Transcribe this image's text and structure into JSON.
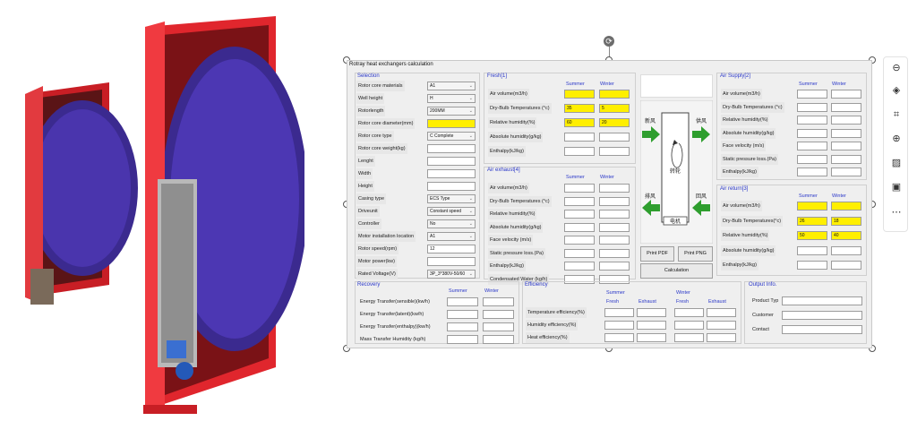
{
  "window_title": "Rotray heat exchangers calculation",
  "selection": {
    "title": "Selection",
    "rows": [
      {
        "label": "Rotor core materials",
        "value": "A1",
        "kind": "select"
      },
      {
        "label": "Well height",
        "value": "H",
        "kind": "select"
      },
      {
        "label": "Rotorlength",
        "value": "200MM",
        "kind": "select"
      },
      {
        "label": "Rotor core diameter(mm)",
        "value": "",
        "kind": "yellow"
      },
      {
        "label": "Rotor core type",
        "value": "C Complete",
        "kind": "select"
      },
      {
        "label": "Rotor core weight(kg)",
        "value": "",
        "kind": "input"
      },
      {
        "label": "Lenght",
        "value": "",
        "kind": "input"
      },
      {
        "label": "Width",
        "value": "",
        "kind": "input"
      },
      {
        "label": "Height",
        "value": "",
        "kind": "input"
      },
      {
        "label": "Casing type",
        "value": "ECS Type",
        "kind": "select"
      },
      {
        "label": "Driveunit",
        "value": "Constant speed",
        "kind": "select"
      },
      {
        "label": "Controller",
        "value": "No",
        "kind": "select"
      },
      {
        "label": "Motor installation location",
        "value": "A1",
        "kind": "select"
      },
      {
        "label": "Rotor speed(rpm)",
        "value": "12",
        "kind": "input"
      },
      {
        "label": "Motor power(kw)",
        "value": "",
        "kind": "input"
      },
      {
        "label": "Rated Voltage(V)",
        "value": "3P_3*380V-50/60",
        "kind": "select"
      }
    ]
  },
  "fresh": {
    "title": "Fresh[1]",
    "summer": "Summer",
    "winter": "Winter",
    "rows": [
      {
        "label": "Air volume(m3/h)",
        "summer": "",
        "winter": "",
        "yellow": true
      },
      {
        "label": "Dry-Bulb Temperatures (°c)",
        "summer": "35",
        "winter": "5",
        "yellow": true
      },
      {
        "label": "Relative humidity(%)",
        "summer": "60",
        "winter": "20",
        "yellow": true
      },
      {
        "label": "Absolute humidity(g/kg)",
        "summer": "",
        "winter": "",
        "yellow": false
      },
      {
        "label": "Enthalpy(kJ/kg)",
        "summer": "",
        "winter": "",
        "yellow": false
      }
    ]
  },
  "exhaust": {
    "title": "Air exhaust[4]",
    "summer": "Summer",
    "winter": "Winter",
    "rows": [
      {
        "label": "Air volume(m3/h)"
      },
      {
        "label": "Dry-Bulb Temperatures (°c)"
      },
      {
        "label": "Relative humidity(%)"
      },
      {
        "label": "Absolute humidity(g/kg)"
      },
      {
        "label": "Face velocity (m/s)"
      },
      {
        "label": "Static pressure loss.(Pa)"
      },
      {
        "label": "Enthalpy(kJ/kg)"
      },
      {
        "label": "Condensated Water (kg/h)"
      }
    ]
  },
  "diagram": {
    "fresh_air": "新风",
    "supply_air": "供风",
    "exhaust_air": "排风",
    "return_air": "回风",
    "rotor": "转轮",
    "motor": "电机",
    "arrow_color": "#2e9e2e"
  },
  "buttons": {
    "print_pdf": "Print PDF",
    "print_png": "Print PNG",
    "calculation": "Calculation"
  },
  "supply": {
    "title": "Air Supply[2]",
    "summer": "Summer",
    "winter": "Winter",
    "rows": [
      {
        "label": "Air volume(m3/h)"
      },
      {
        "label": "Dry-Bulb Temperatures (°c)"
      },
      {
        "label": "Relative humidity(%)"
      },
      {
        "label": "Absolute humidity(g/kg)"
      },
      {
        "label": "Face velocity (m/s)"
      },
      {
        "label": "Static pressure loss.(Pa)"
      },
      {
        "label": "Enthalpy(kJ/kg)"
      }
    ]
  },
  "return": {
    "title": "Air return[3]",
    "summer": "Summer",
    "winter": "Winter",
    "rows": [
      {
        "label": "Air volume(m3/h)",
        "summer": "",
        "winter": "",
        "yellow": true
      },
      {
        "label": "Dry-Bulb Temperatures(°c)",
        "summer": "26",
        "winter": "18",
        "yellow": true
      },
      {
        "label": "Relative humidity(%)",
        "summer": "50",
        "winter": "40",
        "yellow": true
      },
      {
        "label": "Absolute humidity(g/kg)",
        "summer": "",
        "winter": "",
        "yellow": false
      },
      {
        "label": "Enthalpy(kJ/kg)",
        "summer": "",
        "winter": "",
        "yellow": false
      }
    ]
  },
  "recovery": {
    "title": "Recovery",
    "summer": "Summer",
    "winter": "Winter",
    "rows": [
      {
        "label": "Energy Transfer(sensible)(kw/h)"
      },
      {
        "label": "Energy Transfer(latent)(kw/h)"
      },
      {
        "label": "Energy Transfer(enthalpy)(kw/h)"
      },
      {
        "label": "Mass Transfer Humidity (kg/h)"
      }
    ]
  },
  "efficiency": {
    "title": "Efficiency",
    "summer": "Summer",
    "winter": "Winter",
    "fresh": "Fresh",
    "exhaust": "Exhaust",
    "rows": [
      {
        "label": "Temperature efficiency(%)"
      },
      {
        "label": "Humidity efficiency(%)"
      },
      {
        "label": "Heat efficiency(%)"
      }
    ]
  },
  "output": {
    "title": "Output Info.",
    "rows": [
      {
        "label": "Product Typ"
      },
      {
        "label": "Customer"
      },
      {
        "label": "Contact"
      }
    ]
  },
  "toolbar": {
    "items": [
      "minus-icon",
      "layers-icon",
      "crop-icon",
      "zoom-in-icon",
      "pattern-icon",
      "text-recognition-icon",
      "more-icon"
    ]
  },
  "colors": {
    "required_field": "#ffef00",
    "heading": "#2a37c9",
    "casing": "#d8232a",
    "rotor": "#3b2a8f"
  }
}
